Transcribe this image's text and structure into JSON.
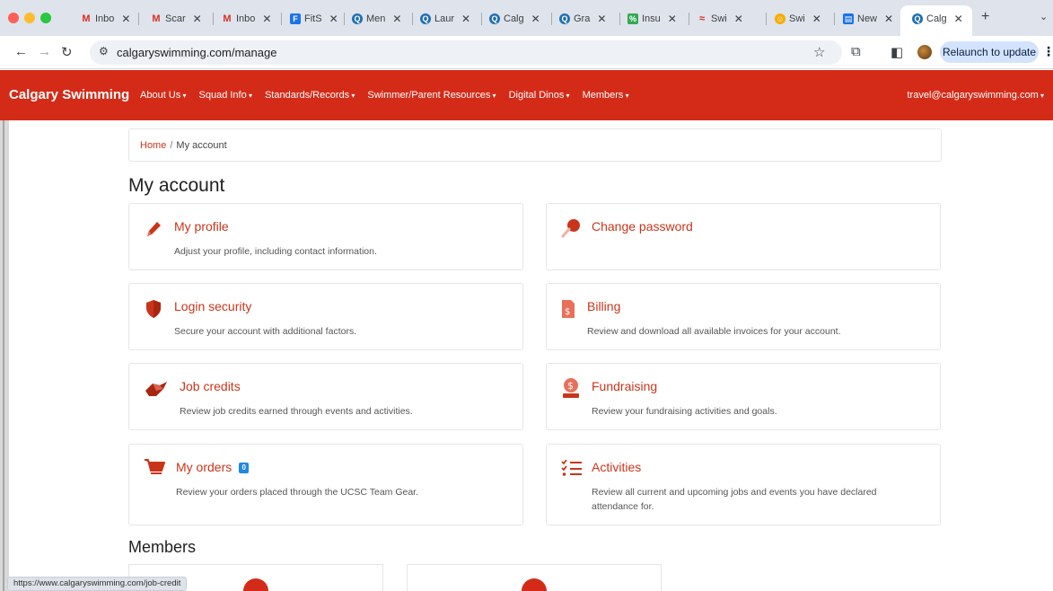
{
  "browser": {
    "tabs": [
      {
        "label": "Inbo",
        "icon": "gmail-icon"
      },
      {
        "label": "Scar",
        "icon": "gmail-icon"
      },
      {
        "label": "Inbo",
        "icon": "gmail-icon"
      },
      {
        "label": "FitS",
        "icon": "fitness-icon"
      },
      {
        "label": "Men",
        "icon": "site-q-icon"
      },
      {
        "label": "Laur",
        "icon": "site-q-icon"
      },
      {
        "label": "Calg",
        "icon": "site-q-icon"
      },
      {
        "label": "Gra",
        "icon": "site-q-icon"
      },
      {
        "label": "Insu",
        "icon": "insurance-icon"
      },
      {
        "label": "Swi",
        "icon": "swim-icon"
      },
      {
        "label": "Swi",
        "icon": "swim-icon"
      },
      {
        "label": "New",
        "icon": "printer-icon"
      },
      {
        "label": "Calg",
        "icon": "site-q-icon",
        "active": true
      }
    ],
    "url": "calgaryswimming.com/manage",
    "relaunch_label": "Relaunch to update",
    "status_url": "https://www.calgaryswimming.com/job-credit"
  },
  "site": {
    "brand": "Calgary Swimming",
    "menu": [
      "About Us",
      "Squad Info",
      "Standards/Records",
      "Swimmer/Parent Resources",
      "Digital Dinos",
      "Members"
    ],
    "user_email": "travel@calgaryswimming.com"
  },
  "breadcrumb": {
    "home": "Home",
    "sep": "/",
    "current": "My account"
  },
  "page_title": "My account",
  "cards": [
    {
      "title": "My profile",
      "desc": "Adjust your profile, including contact information.",
      "icon": "pencil-icon"
    },
    {
      "title": "Change password",
      "desc": "",
      "icon": "key-icon"
    },
    {
      "title": "Login security",
      "desc": "Secure your account with additional factors.",
      "icon": "shield-icon"
    },
    {
      "title": "Billing",
      "desc": "Review and download all available invoices for your account.",
      "icon": "invoice-icon"
    },
    {
      "title": "Job credits",
      "desc": "Review job credits earned through events and activities.",
      "icon": "handshake-icon"
    },
    {
      "title": "Fundraising",
      "desc": "Review your fundraising activities and goals.",
      "icon": "donation-icon"
    },
    {
      "title": "My orders",
      "badge": "0",
      "desc": "Review your orders placed through the UCSC Team Gear.",
      "icon": "cart-icon"
    },
    {
      "title": "Activities",
      "desc": "Review all current and upcoming jobs and events you have declared attendance for.",
      "icon": "checklist-icon"
    }
  ],
  "members_title": "Members",
  "colors": {
    "brand_red": "#d42b18",
    "link_red": "#c9351a",
    "badge_blue": "#1e88e5"
  }
}
